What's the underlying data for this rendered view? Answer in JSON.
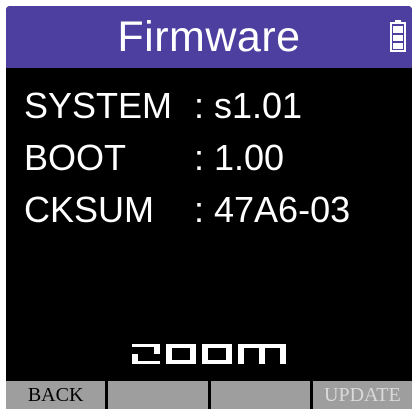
{
  "header": {
    "title": "Firmware",
    "battery_icon": "battery-full-icon",
    "background_color": "#4d3fa0"
  },
  "info": {
    "rows": [
      {
        "label": "SYSTEM",
        "separator": ":",
        "value": "s1.01"
      },
      {
        "label": "BOOT",
        "separator": ":",
        "value": "1.00"
      },
      {
        "label": "CKSUM",
        "separator": ":",
        "value": "47A6-03"
      }
    ]
  },
  "logo": {
    "text": "ZOOM"
  },
  "softkeys": {
    "key1": "BACK",
    "key2": "",
    "key3": "",
    "key4": "UPDATE"
  }
}
